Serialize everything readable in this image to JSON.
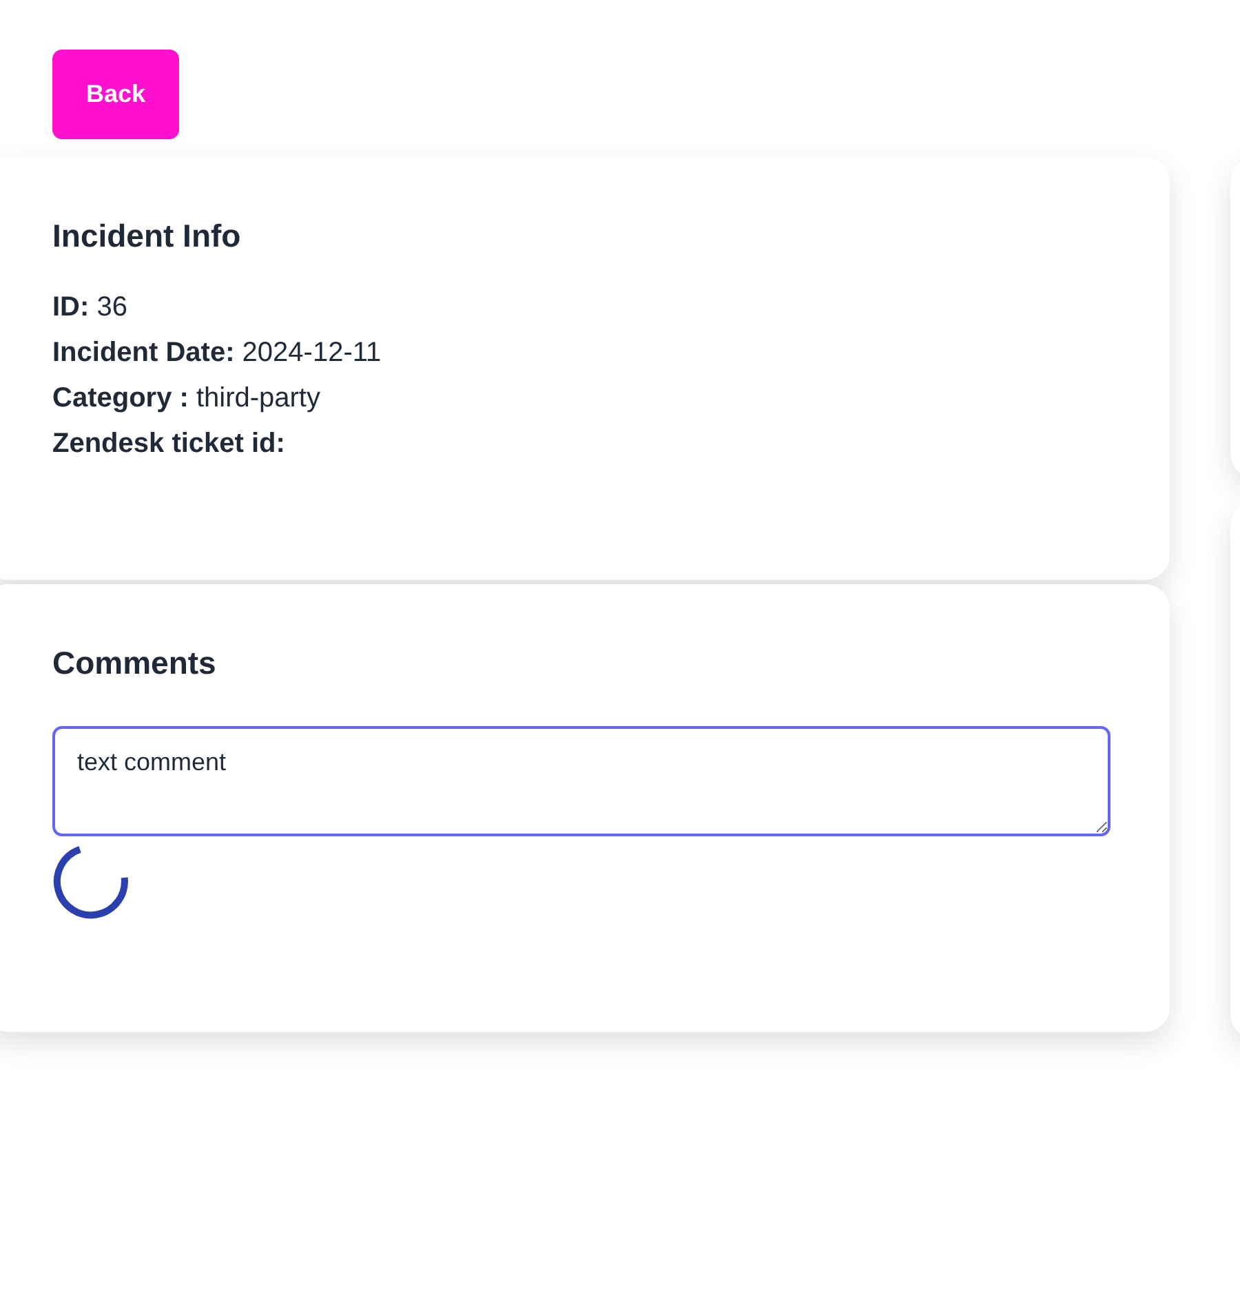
{
  "back_button": {
    "label": "Back"
  },
  "incident_info": {
    "title": "Incident Info",
    "fields": [
      "**ID:** 36",
      "**Incident Date:** 2024-12-11",
      "**Category :** third-party",
      "**Zendesk ticket id:**"
    ]
  },
  "comments": {
    "title": "Comments",
    "input": {
      "value": "text comment",
      "focused": true
    },
    "loading": true
  }
}
